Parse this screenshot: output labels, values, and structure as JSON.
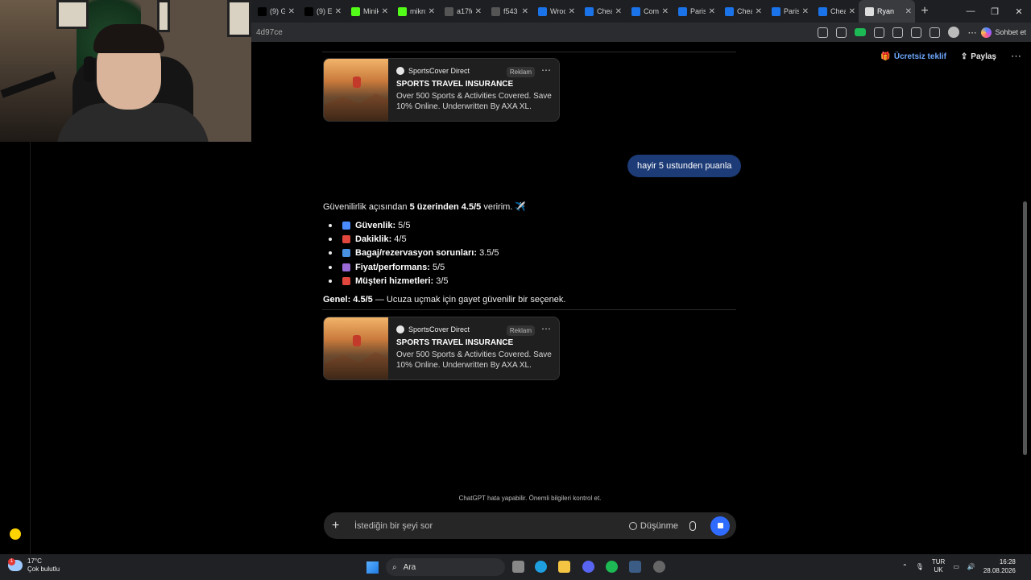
{
  "browser": {
    "tabs": [
      {
        "label": "(9) Ga",
        "icon": "x-logo-icon"
      },
      {
        "label": "(9) Eri",
        "icon": "x-logo-icon"
      },
      {
        "label": "Minik",
        "icon": "kick-icon"
      },
      {
        "label": "mikro",
        "icon": "kick-icon"
      },
      {
        "label": "a17fe",
        "icon": "globe-icon"
      },
      {
        "label": "f543",
        "icon": "globe-icon"
      },
      {
        "label": "Wroc",
        "icon": "cheaptickets-icon"
      },
      {
        "label": "Chea",
        "icon": "cheaptickets-icon"
      },
      {
        "label": "Comp",
        "icon": "cheaptickets-icon"
      },
      {
        "label": "Paris",
        "icon": "cheaptickets-icon"
      },
      {
        "label": "Chea",
        "icon": "cheaptickets-icon"
      },
      {
        "label": "Paris",
        "icon": "cheaptickets-icon"
      },
      {
        "label": "Chea",
        "icon": "cheaptickets-icon"
      },
      {
        "label": "Ryan",
        "icon": "openai-icon",
        "active": true
      }
    ],
    "address_fragment": "4d97ce",
    "chat_button": "Sohbet et"
  },
  "header_actions": {
    "offer": "Ücretsiz teklif",
    "share": "Paylaş"
  },
  "ad": {
    "brand": "SportsCover Direct",
    "tag": "Reklam",
    "title": "SPORTS TRAVEL INSURANCE",
    "description": "Over 500 Sports & Activities Covered. Save 10% Online. Underwritten By AXA XL."
  },
  "user_message": "hayir 5 ustunden puanla",
  "answer": {
    "intro_pre": "Güvenilirlik açısından ",
    "intro_bold": "5 üzerinden 4.5/5",
    "intro_post": " veririm. ✈️",
    "items": [
      {
        "label": "Güvenlik:",
        "value": " 5/5",
        "icon_color": "#4a8cff"
      },
      {
        "label": "Dakiklik:",
        "value": " 4/5",
        "icon_color": "#e0463c"
      },
      {
        "label": "Bagaj/rezervasyon sorunları:",
        "value": " 3.5/5",
        "icon_color": "#4a90e2"
      },
      {
        "label": "Fiyat/performans:",
        "value": " 5/5",
        "icon_color": "#9a6bd6"
      },
      {
        "label": "Müşteri hizmetleri:",
        "value": " 3/5",
        "icon_color": "#e0463c"
      }
    ],
    "summary_bold": "Genel: 4.5/5",
    "summary_rest": " — Ucuza uçmak için gayet güvenilir bir seçenek."
  },
  "disclaimer": "ChatGPT hata yapabilir. Önemli bilgileri kontrol et.",
  "composer": {
    "placeholder": "İstediğin bir şeyi sor",
    "think_label": "Düşünme"
  },
  "taskbar": {
    "temperature": "17°C",
    "weather": "Çok bulutlu",
    "weather_badge": "1",
    "search_label": "Ara",
    "lang_top": "TUR",
    "lang_bottom": "UK",
    "time": "16:28",
    "date": "28.08.2026"
  },
  "colors": {
    "accent_blue": "#2f6bff",
    "user_bubble": "#1d3b76",
    "link_blue": "#6ea8ff"
  }
}
